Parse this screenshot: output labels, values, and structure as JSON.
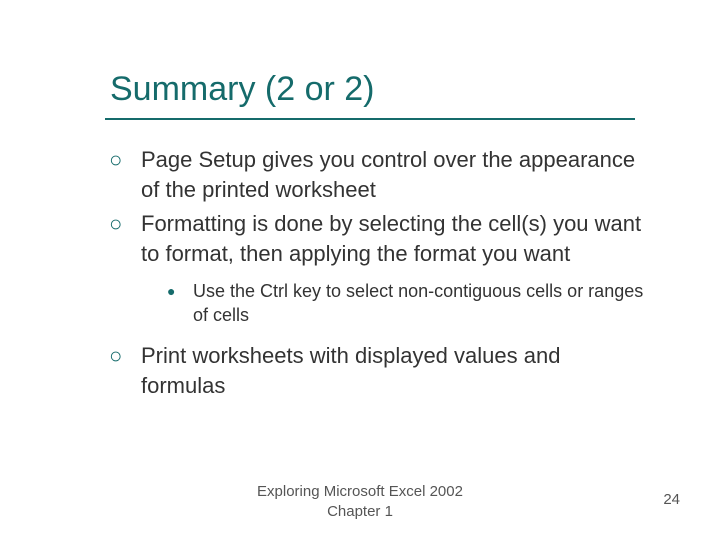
{
  "slide": {
    "title": "Summary (2 or 2)",
    "bullets": [
      {
        "text": "Page Setup gives you control over the appearance of the printed worksheet"
      },
      {
        "text": "Formatting is done by selecting the cell(s) you want to format, then applying the format you want",
        "sub": [
          "Use the Ctrl key to select non-contiguous cells or ranges of cells"
        ]
      },
      {
        "text": "Print worksheets with displayed values and formulas"
      }
    ],
    "footer_line1": "Exploring Microsoft Excel 2002",
    "footer_line2": "Chapter 1",
    "page_number": "24"
  }
}
